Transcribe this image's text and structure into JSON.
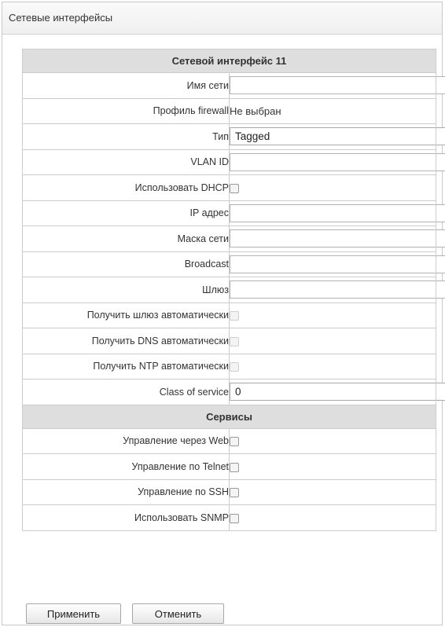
{
  "panel": {
    "title": "Сетевые интерфейсы"
  },
  "section_main": {
    "title": "Сетевой интерфейс 11"
  },
  "fields": {
    "network_name": {
      "label": "Имя сети",
      "value": ""
    },
    "firewall_profile": {
      "label": "Профиль firewall",
      "value": "Не выбран"
    },
    "type": {
      "label": "Тип",
      "value": "Tagged"
    },
    "vlan_id": {
      "label": "VLAN ID",
      "value": ""
    },
    "use_dhcp": {
      "label": "Использовать DHCP",
      "checked": false
    },
    "ip_address": {
      "label": "IP адрес",
      "value": ""
    },
    "netmask": {
      "label": "Маска сети",
      "value": ""
    },
    "broadcast": {
      "label": "Broadcast",
      "value": ""
    },
    "gateway": {
      "label": "Шлюз",
      "value": ""
    },
    "auto_gateway": {
      "label": "Получить шлюз автоматически",
      "checked": false,
      "disabled": true
    },
    "auto_dns": {
      "label": "Получить DNS автоматически",
      "checked": false,
      "disabled": true
    },
    "auto_ntp": {
      "label": "Получить NTP автоматически",
      "checked": false,
      "disabled": true
    },
    "class_of_service": {
      "label": "Class of service",
      "value": "0"
    }
  },
  "section_services": {
    "title": "Сервисы"
  },
  "services": {
    "web": {
      "label": "Управление через Web",
      "checked": false
    },
    "telnet": {
      "label": "Управление по Telnet",
      "checked": false
    },
    "ssh": {
      "label": "Управление по SSH",
      "checked": false
    },
    "snmp": {
      "label": "Использовать SNMP",
      "checked": false
    }
  },
  "buttons": {
    "apply": "Применить",
    "cancel": "Отменить"
  },
  "icons": {
    "dropdown": "dropdown-arrow-icon"
  }
}
